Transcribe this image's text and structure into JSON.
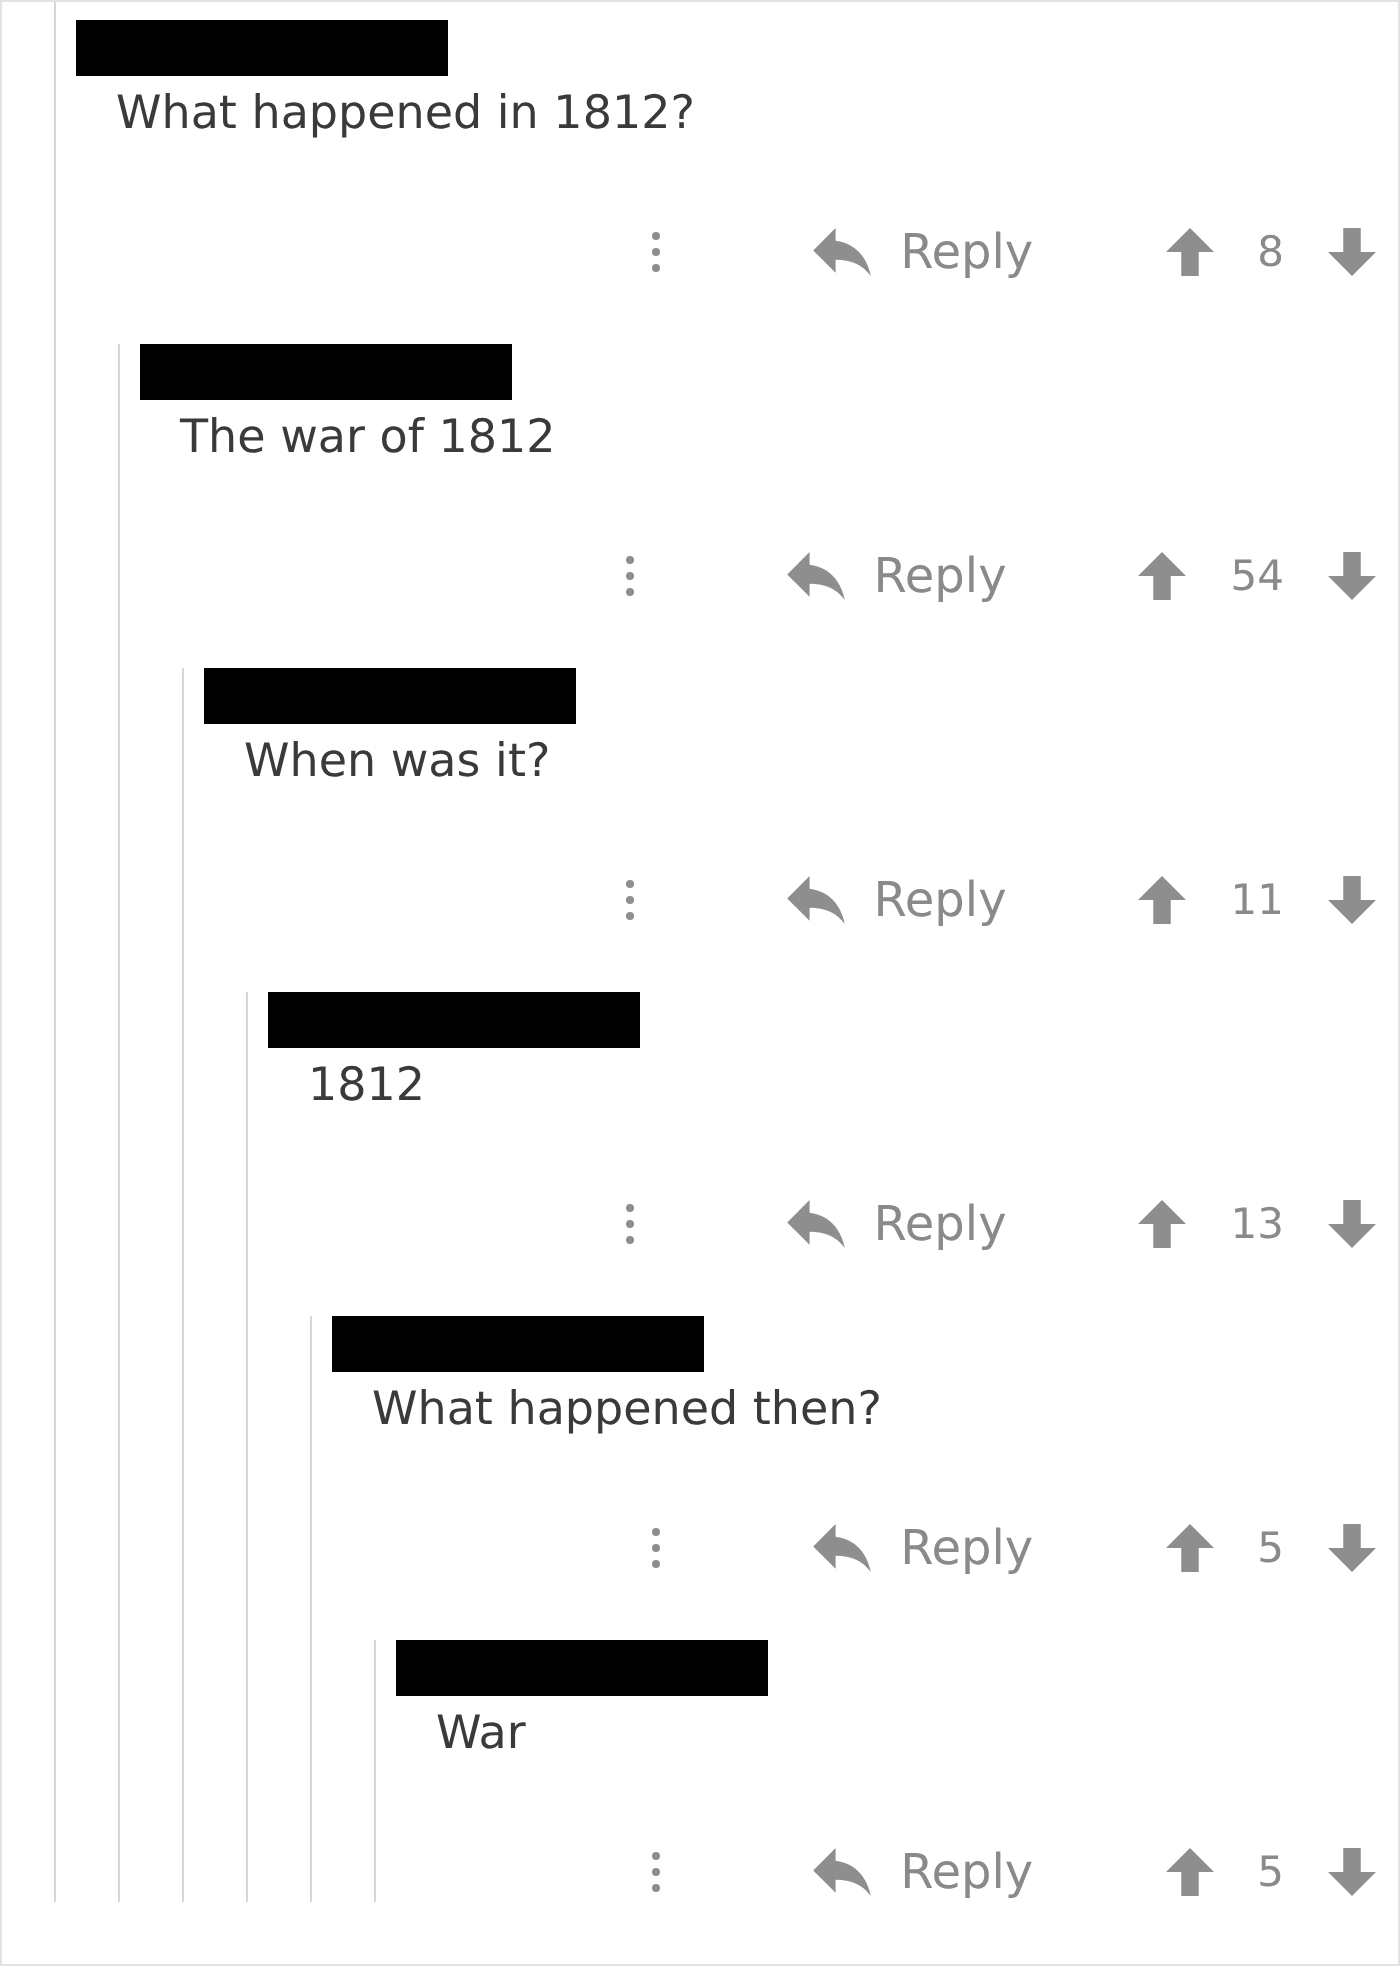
{
  "comments": [
    {
      "name_redacted": true,
      "text": "What happened in 1812?",
      "reply": "Reply",
      "score": "8",
      "children": [
        {
          "name_redacted": true,
          "text": "The war of 1812",
          "reply": "Reply",
          "score": "54",
          "children": [
            {
              "name_redacted": true,
              "text": "When was it?",
              "reply": "Reply",
              "score": "11",
              "children": [
                {
                  "name_redacted": true,
                  "text": "1812",
                  "reply": "Reply",
                  "score": "13",
                  "children": [
                    {
                      "name_redacted": true,
                      "text": "What happened then?",
                      "reply": "Reply",
                      "score": "5",
                      "children": [
                        {
                          "name_redacted": true,
                          "text": "War",
                          "reply": "Reply",
                          "score": "5"
                        }
                      ]
                    }
                  ]
                }
              ]
            }
          ]
        }
      ]
    }
  ]
}
